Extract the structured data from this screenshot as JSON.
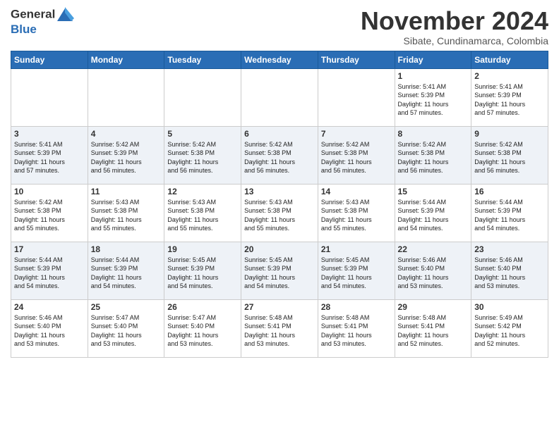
{
  "logo": {
    "line1": "General",
    "line2": "Blue"
  },
  "title": "November 2024",
  "subtitle": "Sibate, Cundinamarca, Colombia",
  "days_header": [
    "Sunday",
    "Monday",
    "Tuesday",
    "Wednesday",
    "Thursday",
    "Friday",
    "Saturday"
  ],
  "weeks": [
    [
      {
        "day": "",
        "info": ""
      },
      {
        "day": "",
        "info": ""
      },
      {
        "day": "",
        "info": ""
      },
      {
        "day": "",
        "info": ""
      },
      {
        "day": "",
        "info": ""
      },
      {
        "day": "1",
        "info": "Sunrise: 5:41 AM\nSunset: 5:39 PM\nDaylight: 11 hours\nand 57 minutes."
      },
      {
        "day": "2",
        "info": "Sunrise: 5:41 AM\nSunset: 5:39 PM\nDaylight: 11 hours\nand 57 minutes."
      }
    ],
    [
      {
        "day": "3",
        "info": "Sunrise: 5:41 AM\nSunset: 5:39 PM\nDaylight: 11 hours\nand 57 minutes."
      },
      {
        "day": "4",
        "info": "Sunrise: 5:42 AM\nSunset: 5:39 PM\nDaylight: 11 hours\nand 56 minutes."
      },
      {
        "day": "5",
        "info": "Sunrise: 5:42 AM\nSunset: 5:38 PM\nDaylight: 11 hours\nand 56 minutes."
      },
      {
        "day": "6",
        "info": "Sunrise: 5:42 AM\nSunset: 5:38 PM\nDaylight: 11 hours\nand 56 minutes."
      },
      {
        "day": "7",
        "info": "Sunrise: 5:42 AM\nSunset: 5:38 PM\nDaylight: 11 hours\nand 56 minutes."
      },
      {
        "day": "8",
        "info": "Sunrise: 5:42 AM\nSunset: 5:38 PM\nDaylight: 11 hours\nand 56 minutes."
      },
      {
        "day": "9",
        "info": "Sunrise: 5:42 AM\nSunset: 5:38 PM\nDaylight: 11 hours\nand 56 minutes."
      }
    ],
    [
      {
        "day": "10",
        "info": "Sunrise: 5:42 AM\nSunset: 5:38 PM\nDaylight: 11 hours\nand 55 minutes."
      },
      {
        "day": "11",
        "info": "Sunrise: 5:43 AM\nSunset: 5:38 PM\nDaylight: 11 hours\nand 55 minutes."
      },
      {
        "day": "12",
        "info": "Sunrise: 5:43 AM\nSunset: 5:38 PM\nDaylight: 11 hours\nand 55 minutes."
      },
      {
        "day": "13",
        "info": "Sunrise: 5:43 AM\nSunset: 5:38 PM\nDaylight: 11 hours\nand 55 minutes."
      },
      {
        "day": "14",
        "info": "Sunrise: 5:43 AM\nSunset: 5:38 PM\nDaylight: 11 hours\nand 55 minutes."
      },
      {
        "day": "15",
        "info": "Sunrise: 5:44 AM\nSunset: 5:39 PM\nDaylight: 11 hours\nand 54 minutes."
      },
      {
        "day": "16",
        "info": "Sunrise: 5:44 AM\nSunset: 5:39 PM\nDaylight: 11 hours\nand 54 minutes."
      }
    ],
    [
      {
        "day": "17",
        "info": "Sunrise: 5:44 AM\nSunset: 5:39 PM\nDaylight: 11 hours\nand 54 minutes."
      },
      {
        "day": "18",
        "info": "Sunrise: 5:44 AM\nSunset: 5:39 PM\nDaylight: 11 hours\nand 54 minutes."
      },
      {
        "day": "19",
        "info": "Sunrise: 5:45 AM\nSunset: 5:39 PM\nDaylight: 11 hours\nand 54 minutes."
      },
      {
        "day": "20",
        "info": "Sunrise: 5:45 AM\nSunset: 5:39 PM\nDaylight: 11 hours\nand 54 minutes."
      },
      {
        "day": "21",
        "info": "Sunrise: 5:45 AM\nSunset: 5:39 PM\nDaylight: 11 hours\nand 54 minutes."
      },
      {
        "day": "22",
        "info": "Sunrise: 5:46 AM\nSunset: 5:40 PM\nDaylight: 11 hours\nand 53 minutes."
      },
      {
        "day": "23",
        "info": "Sunrise: 5:46 AM\nSunset: 5:40 PM\nDaylight: 11 hours\nand 53 minutes."
      }
    ],
    [
      {
        "day": "24",
        "info": "Sunrise: 5:46 AM\nSunset: 5:40 PM\nDaylight: 11 hours\nand 53 minutes."
      },
      {
        "day": "25",
        "info": "Sunrise: 5:47 AM\nSunset: 5:40 PM\nDaylight: 11 hours\nand 53 minutes."
      },
      {
        "day": "26",
        "info": "Sunrise: 5:47 AM\nSunset: 5:40 PM\nDaylight: 11 hours\nand 53 minutes."
      },
      {
        "day": "27",
        "info": "Sunrise: 5:48 AM\nSunset: 5:41 PM\nDaylight: 11 hours\nand 53 minutes."
      },
      {
        "day": "28",
        "info": "Sunrise: 5:48 AM\nSunset: 5:41 PM\nDaylight: 11 hours\nand 53 minutes."
      },
      {
        "day": "29",
        "info": "Sunrise: 5:48 AM\nSunset: 5:41 PM\nDaylight: 11 hours\nand 52 minutes."
      },
      {
        "day": "30",
        "info": "Sunrise: 5:49 AM\nSunset: 5:42 PM\nDaylight: 11 hours\nand 52 minutes."
      }
    ]
  ]
}
